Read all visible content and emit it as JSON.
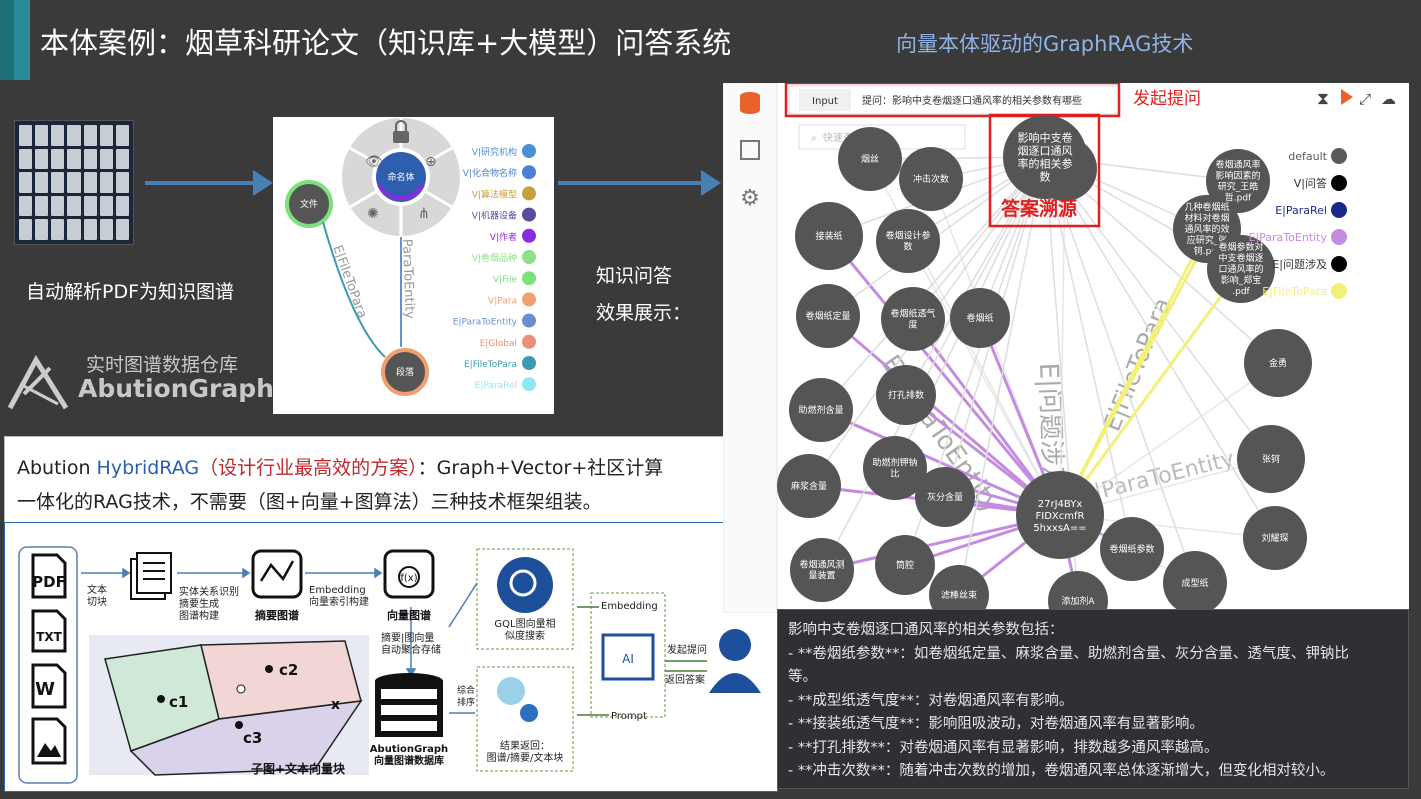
{
  "header": {
    "title": "本体案例：烟草科研论文（知识库+大模型）问答系统",
    "subtitle": "向量本体驱动的GraphRAG技术"
  },
  "left": {
    "pdf_caption": "自动解析PDF为知识图谱",
    "qa_label_1": "知识问答",
    "qa_label_2": "效果展示：",
    "logo_cn": "实时图谱数据仓库",
    "logo_en": "AbutionGraph"
  },
  "schema": {
    "center": "命名体",
    "doc_node": "文件",
    "para_node": "段落",
    "edge1": "E|FileToPara",
    "edge2": "ParaToEntity",
    "legend": [
      {
        "label": "V|研究机构",
        "color": "#4a90d9"
      },
      {
        "label": "V|化合物名称",
        "color": "#4a7fd9"
      },
      {
        "label": "V|算法模型",
        "color": "#c8a13a"
      },
      {
        "label": "V|机器设备",
        "color": "#5a4aa0"
      },
      {
        "label": "V|作者",
        "color": "#8a2be2"
      },
      {
        "label": "V|卷烟品种",
        "color": "#8ee08a"
      },
      {
        "label": "V|File",
        "color": "#7ce07c"
      },
      {
        "label": "V|Para",
        "color": "#f0a070"
      },
      {
        "label": "E|ParaToEntity",
        "color": "#6a8fd0"
      },
      {
        "label": "E|Global",
        "color": "#e8907a"
      },
      {
        "label": "E|FileToPara",
        "color": "#3a9ab0"
      },
      {
        "label": "E|ParaRel",
        "color": "#8ee8f0"
      }
    ]
  },
  "hybrid": {
    "prefix": "Abution ",
    "brand": "HybridRAG",
    "highlight": "（设计行业最高效的方案）",
    "line1_rest": "：Graph+Vector+社区计算",
    "line2": "一体化的RAG技术，不需要（图+向量+图算法）三种技术框架组装。"
  },
  "pipeline": {
    "text_chunk": "文本\n切块",
    "extract": "实体关系识别\n摘要生成\n图谱构建",
    "summary_graph": "摘要图谱",
    "embedding_index": "Embedding\n向量索引构建",
    "vector_graph": "向量图谱",
    "store": "摘要|图向量\n自动聚合存储",
    "gql_search": "GQL图向量相\n似度搜索",
    "db_name": "AbutionGraph\n向量图谱数据库",
    "combined_sort": "综合\n排序",
    "results": "结果返回：\n图谱/摘要/文本块",
    "embedding": "Embedding",
    "prompt": "Prompt",
    "ask": "发起提问",
    "return_answer": "返回答案",
    "subgraph_caption": "子图+文本向量块",
    "file_icons": [
      "PDF",
      "TXT",
      "W"
    ],
    "clusters": [
      "c1",
      "c2",
      "c3",
      "x"
    ]
  },
  "graph_ui": {
    "input_tab": "Input",
    "question": "提问：影响中支卷烟逐口通风率的相关参数有哪些",
    "search_placeholder": "快速查找",
    "ask_annotation": "发起提问",
    "trace_annotation": "答案溯源",
    "query_node": "影响中支卷烟逐口通风率的相关参数",
    "center_node": "27rJ4BYxFIDXcmfR5hxxsA==",
    "nodes": [
      "烟丝",
      "冲击次数",
      "河南中烟",
      "卷烟通风率影响因素的研究_王皓哲.pdf",
      "几种卷烟纸材料对卷烟通风率的效应研究_张钶.pdf",
      "接装纸",
      "卷烟设计参数",
      "卷烟纸定量",
      "卷烟纸透气度",
      "卷烟纸",
      "卷烟参数对中支卷烟逐口通风率的影响_郑宝.pdf",
      "金勇",
      "打孔排数",
      "助燃剂含量",
      "助燃剂钾钠比",
      "麻浆含量",
      "灰分含量",
      "张钶",
      "卷烟纸参数",
      "刘耀琛",
      "卷烟通风测量装置",
      "筒腔",
      "滤棒丝束",
      "添加剂A",
      "成型纸"
    ],
    "legend": [
      {
        "label": "default",
        "color": "#5a5a5a"
      },
      {
        "label": "V|问答",
        "color": "#000000"
      },
      {
        "label": "E|ParaRel",
        "color": "#1a2a8a"
      },
      {
        "label": "E|ParaToEntity",
        "color": "#c58be0"
      },
      {
        "label": "E|问题涉及",
        "color": "#000000"
      },
      {
        "label": "E|FileToPara",
        "color": "#f3f07a"
      }
    ],
    "edge_labels": [
      "E|问题涉及",
      "E|ParaToEntity",
      "E|FileToPara"
    ]
  },
  "answer": {
    "lines": [
      "影响中支卷烟逐口通风率的相关参数包括：",
      "- **卷烟纸参数**：如卷烟纸定量、麻浆含量、助燃剂含量、灰分含量、透气度、钾钠比",
      "等。",
      "- **成型纸透气度**：对卷烟通风率有影响。",
      "- **接装纸透气度**：影响阻吸波动，对卷烟通风率有显著影响。",
      "- **打孔排数**：对卷烟通风率有显著影响，排数越多通风率越高。",
      "- **冲击次数**：随着冲击次数的增加，卷烟通风率总体逐渐增大，但变化相对较小。"
    ]
  }
}
